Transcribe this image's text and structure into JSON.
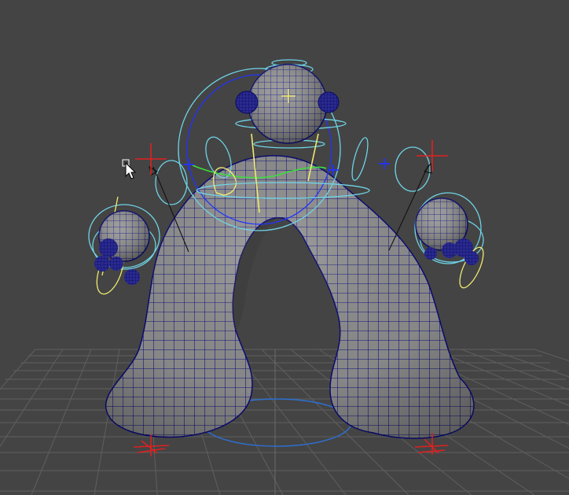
{
  "colors": {
    "background": "#444444",
    "grid": "#5f5f5f",
    "mesh_fill": "#8f8f8f",
    "mesh_shade": "#5c5c5c",
    "wireframe": "#0a0a7a",
    "control_cyan": "#6fd3e6",
    "control_yellow": "#f0ea70",
    "control_green": "#3ce03c",
    "control_red": "#e02020",
    "control_blue": "#2233ff",
    "pole_vector_line": "#111111"
  },
  "icons": {
    "cursor": "mouse-pointer-icon",
    "locator": "locator-cross-icon",
    "ik_handle": "ik-handle-icon"
  }
}
